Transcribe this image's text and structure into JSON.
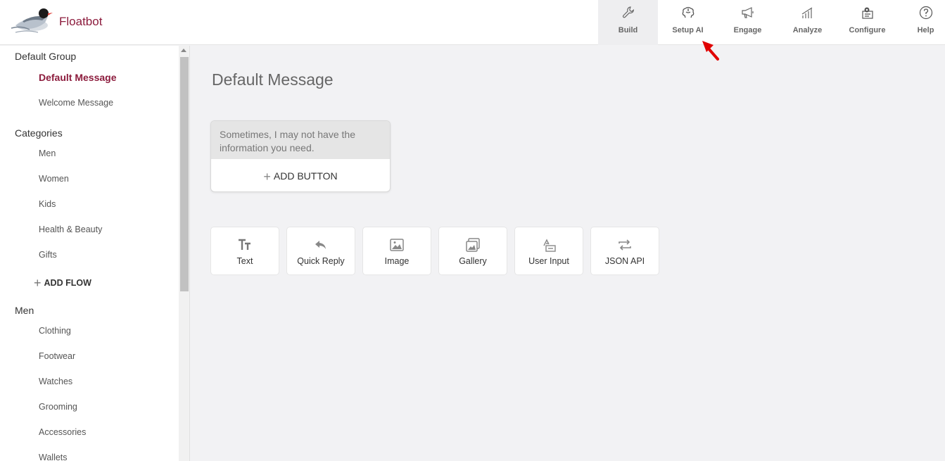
{
  "app": {
    "brand": "Floatbot"
  },
  "nav": [
    {
      "label": "Build",
      "icon": "wrench-icon",
      "active": true
    },
    {
      "label": "Setup AI",
      "icon": "brain-icon",
      "active": false
    },
    {
      "label": "Engage",
      "icon": "megaphone-icon",
      "active": false
    },
    {
      "label": "Analyze",
      "icon": "bar-chart-icon",
      "active": false
    },
    {
      "label": "Configure",
      "icon": "gear-box-icon",
      "active": false
    },
    {
      "label": "Help",
      "icon": "help-icon",
      "active": false
    }
  ],
  "sidebar": {
    "default_group": {
      "title": "Default Group",
      "items": [
        "Default Message",
        "Welcome Message"
      ],
      "active": "Default Message"
    },
    "categories": {
      "title": "Categories",
      "items": [
        "Men",
        "Women",
        "Kids",
        "Health & Beauty",
        "Gifts"
      ],
      "add_label": "ADD FLOW"
    },
    "men": {
      "title": "Men",
      "items": [
        "Clothing",
        "Footwear",
        "Watches",
        "Grooming",
        "Accessories",
        "Wallets"
      ]
    }
  },
  "main": {
    "title": "Default Message",
    "message_text": "Sometimes, I may not have the information you need.",
    "add_button_label": "ADD BUTTON",
    "tools": [
      {
        "label": "Text",
        "icon": "text-format-icon"
      },
      {
        "label": "Quick Reply",
        "icon": "reply-icon"
      },
      {
        "label": "Image",
        "icon": "image-icon"
      },
      {
        "label": "Gallery",
        "icon": "gallery-icon"
      },
      {
        "label": "User Input",
        "icon": "user-input-icon"
      },
      {
        "label": "JSON API",
        "icon": "api-icon"
      }
    ]
  },
  "colors": {
    "brand": "#8c1c3d",
    "annotation_arrow": "#e00000"
  }
}
